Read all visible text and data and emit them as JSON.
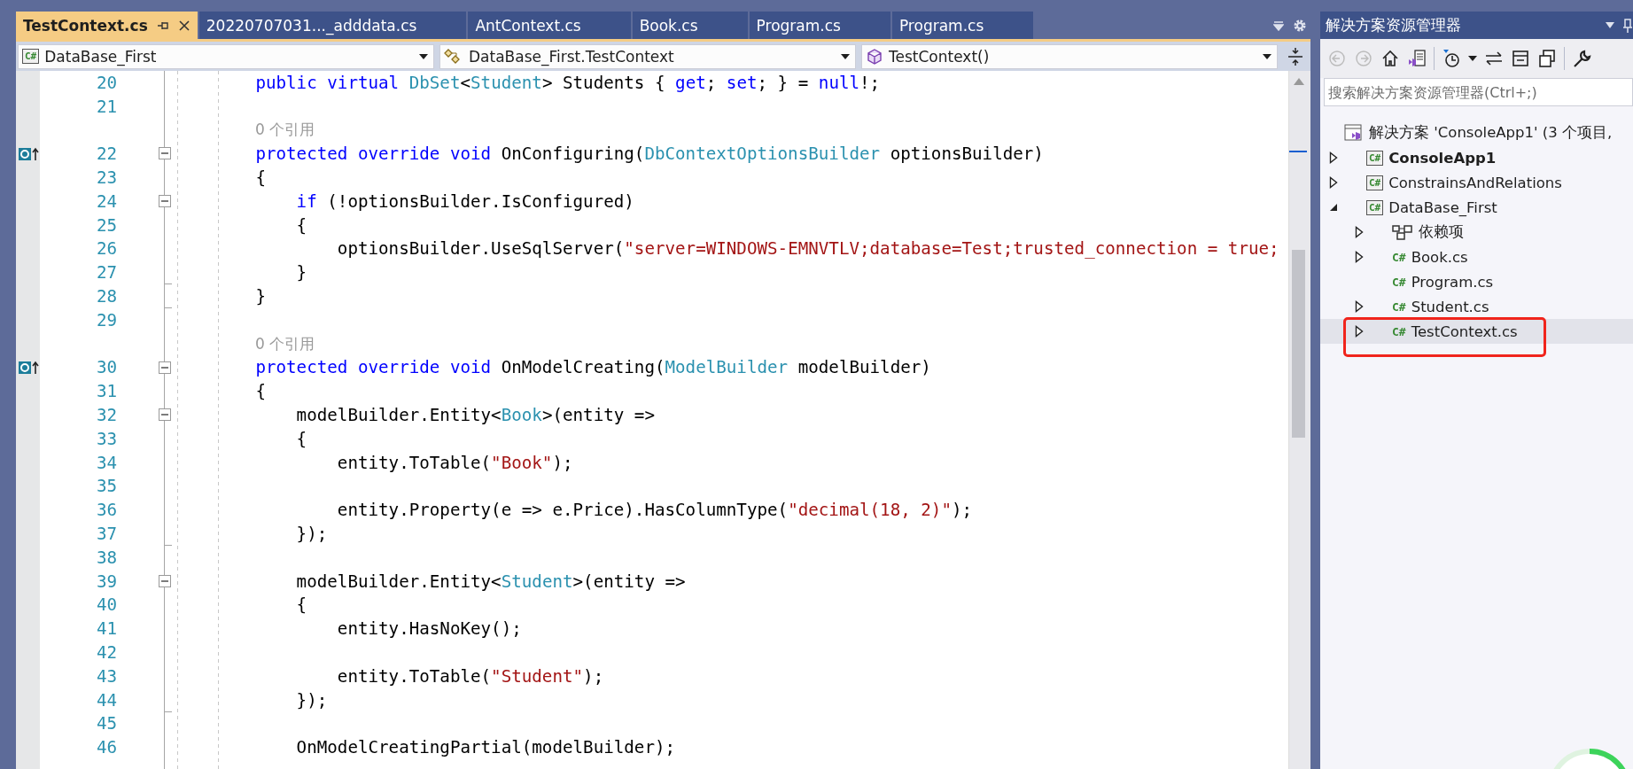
{
  "tabs": [
    {
      "label": "TestContext.cs",
      "selected": true
    },
    {
      "label": "20220707031..._adddata.cs",
      "selected": false
    },
    {
      "label": "AntContext.cs",
      "selected": false
    },
    {
      "label": "Book.cs",
      "selected": false
    },
    {
      "label": "Program.cs",
      "selected": false
    },
    {
      "label": "Program.cs",
      "selected": false
    }
  ],
  "navigation_bar": {
    "project": {
      "badge": "C#",
      "value": "DataBase_First"
    },
    "type": {
      "value": "DataBase_First.TestContext"
    },
    "member": {
      "value": "TestContext()"
    }
  },
  "editor": {
    "lines": [
      {
        "kind": "code",
        "number": "20",
        "collapsible": false,
        "block_end": false,
        "override": false,
        "segments": [
          {
            "kind": "keyword",
            "text": "        public virtual"
          },
          {
            "kind": "type",
            "text": " DbSet"
          },
          {
            "kind": "plain",
            "text": "<"
          },
          {
            "kind": "type",
            "text": "Student"
          },
          {
            "kind": "plain",
            "text": "> Students { "
          },
          {
            "kind": "keyword",
            "text": "get"
          },
          {
            "kind": "plain",
            "text": "; "
          },
          {
            "kind": "keyword",
            "text": "set"
          },
          {
            "kind": "plain",
            "text": "; } = "
          },
          {
            "kind": "keyword",
            "text": "null"
          },
          {
            "kind": "plain",
            "text": "!;"
          }
        ]
      },
      {
        "kind": "code",
        "number": "21",
        "collapsible": false,
        "block_end": false,
        "override": false
      },
      {
        "kind": "lens",
        "text": "0 个引用"
      },
      {
        "kind": "code",
        "number": "22",
        "collapsible": true,
        "block_end": false,
        "override": true,
        "segments": [
          {
            "kind": "keyword",
            "text": "        protected override void"
          },
          {
            "kind": "plain",
            "text": " OnConfiguring("
          },
          {
            "kind": "type",
            "text": "DbContextOptionsBuilder"
          },
          {
            "kind": "plain",
            "text": " optionsBuilder)"
          }
        ]
      },
      {
        "kind": "code",
        "number": "23",
        "collapsible": false,
        "block_end": false,
        "override": false,
        "segments": [
          {
            "kind": "plain",
            "text": "        {"
          }
        ]
      },
      {
        "kind": "code",
        "number": "24",
        "collapsible": true,
        "block_end": false,
        "override": false,
        "segments": [
          {
            "kind": "keyword",
            "text": "            if"
          },
          {
            "kind": "plain",
            "text": " (!optionsBuilder.IsConfigured)"
          }
        ]
      },
      {
        "kind": "code",
        "number": "25",
        "collapsible": false,
        "block_end": false,
        "override": false,
        "segments": [
          {
            "kind": "plain",
            "text": "            {"
          }
        ]
      },
      {
        "kind": "code",
        "number": "26",
        "collapsible": false,
        "block_end": false,
        "override": false,
        "segments": [
          {
            "kind": "plain",
            "text": "                optionsBuilder.UseSqlServer("
          },
          {
            "kind": "string",
            "text": "\"server=WINDOWS-EMNVTLV;database=Test;trusted_connection = true;"
          }
        ]
      },
      {
        "kind": "code",
        "number": "27",
        "collapsible": false,
        "block_end": true,
        "override": false,
        "segments": [
          {
            "kind": "plain",
            "text": "            }"
          }
        ]
      },
      {
        "kind": "code",
        "number": "28",
        "collapsible": false,
        "block_end": true,
        "override": false,
        "segments": [
          {
            "kind": "plain",
            "text": "        }"
          }
        ]
      },
      {
        "kind": "code",
        "number": "29",
        "collapsible": false,
        "block_end": false,
        "override": false
      },
      {
        "kind": "lens",
        "text": "0 个引用"
      },
      {
        "kind": "code",
        "number": "30",
        "collapsible": true,
        "block_end": false,
        "override": true,
        "segments": [
          {
            "kind": "keyword",
            "text": "        protected override void"
          },
          {
            "kind": "plain",
            "text": " OnModelCreating("
          },
          {
            "kind": "type",
            "text": "ModelBuilder"
          },
          {
            "kind": "plain",
            "text": " modelBuilder)"
          }
        ]
      },
      {
        "kind": "code",
        "number": "31",
        "collapsible": false,
        "block_end": false,
        "override": false,
        "segments": [
          {
            "kind": "plain",
            "text": "        {"
          }
        ]
      },
      {
        "kind": "code",
        "number": "32",
        "collapsible": true,
        "block_end": false,
        "override": false,
        "segments": [
          {
            "kind": "plain",
            "text": "            modelBuilder.Entity<"
          },
          {
            "kind": "type",
            "text": "Book"
          },
          {
            "kind": "plain",
            "text": ">(entity =>"
          }
        ]
      },
      {
        "kind": "code",
        "number": "33",
        "collapsible": false,
        "block_end": false,
        "override": false,
        "segments": [
          {
            "kind": "plain",
            "text": "            {"
          }
        ]
      },
      {
        "kind": "code",
        "number": "34",
        "collapsible": false,
        "block_end": false,
        "override": false,
        "segments": [
          {
            "kind": "plain",
            "text": "                entity.ToTable("
          },
          {
            "kind": "string",
            "text": "\"Book\""
          },
          {
            "kind": "plain",
            "text": ");"
          }
        ]
      },
      {
        "kind": "code",
        "number": "35",
        "collapsible": false,
        "block_end": false,
        "override": false
      },
      {
        "kind": "code",
        "number": "36",
        "collapsible": false,
        "block_end": false,
        "override": false,
        "segments": [
          {
            "kind": "plain",
            "text": "                entity.Property(e => e.Price).HasColumnType("
          },
          {
            "kind": "string",
            "text": "\"decimal(18, 2)\""
          },
          {
            "kind": "plain",
            "text": ");"
          }
        ]
      },
      {
        "kind": "code",
        "number": "37",
        "collapsible": false,
        "block_end": true,
        "override": false,
        "segments": [
          {
            "kind": "plain",
            "text": "            });"
          }
        ]
      },
      {
        "kind": "code",
        "number": "38",
        "collapsible": false,
        "block_end": false,
        "override": false
      },
      {
        "kind": "code",
        "number": "39",
        "collapsible": true,
        "block_end": false,
        "override": false,
        "segments": [
          {
            "kind": "plain",
            "text": "            modelBuilder.Entity<"
          },
          {
            "kind": "type",
            "text": "Student"
          },
          {
            "kind": "plain",
            "text": ">(entity =>"
          }
        ]
      },
      {
        "kind": "code",
        "number": "40",
        "collapsible": false,
        "block_end": false,
        "override": false,
        "segments": [
          {
            "kind": "plain",
            "text": "            {"
          }
        ]
      },
      {
        "kind": "code",
        "number": "41",
        "collapsible": false,
        "block_end": false,
        "override": false,
        "segments": [
          {
            "kind": "plain",
            "text": "                entity.HasNoKey();"
          }
        ]
      },
      {
        "kind": "code",
        "number": "42",
        "collapsible": false,
        "block_end": false,
        "override": false
      },
      {
        "kind": "code",
        "number": "43",
        "collapsible": false,
        "block_end": false,
        "override": false,
        "segments": [
          {
            "kind": "plain",
            "text": "                entity.ToTable("
          },
          {
            "kind": "string",
            "text": "\"Student\""
          },
          {
            "kind": "plain",
            "text": ");"
          }
        ]
      },
      {
        "kind": "code",
        "number": "44",
        "collapsible": false,
        "block_end": true,
        "override": false,
        "segments": [
          {
            "kind": "plain",
            "text": "            });"
          }
        ]
      },
      {
        "kind": "code",
        "number": "45",
        "collapsible": false,
        "block_end": false,
        "override": false
      },
      {
        "kind": "code",
        "number": "46",
        "collapsible": false,
        "block_end": false,
        "override": false,
        "segments": [
          {
            "kind": "plain",
            "text": "            OnModelCreatingPartial(modelBuilder);"
          }
        ]
      }
    ]
  },
  "solution_explorer": {
    "title": "解决方案资源管理器",
    "search": {
      "placeholder": "搜索解决方案资源管理器(Ctrl+;)"
    },
    "tree": [
      {
        "kind": "solution",
        "label": "解决方案 'ConsoleApp1' (3 个项目,",
        "expandable": false,
        "bold": false,
        "selected": false,
        "boxed": false,
        "children": [
          {
            "kind": "project",
            "badge": "C#",
            "label": "ConsoleApp1",
            "expandable": true,
            "expanded": false,
            "bold": true,
            "selected": false,
            "boxed": false
          },
          {
            "kind": "project",
            "badge": "C#",
            "label": "ConstrainsAndRelations",
            "expandable": true,
            "expanded": false,
            "bold": false,
            "selected": false,
            "boxed": false
          },
          {
            "kind": "project",
            "badge": "C#",
            "label": "DataBase_First",
            "expandable": true,
            "expanded": true,
            "bold": false,
            "selected": false,
            "boxed": false,
            "children": [
              {
                "kind": "dependencies",
                "label": "依赖项",
                "expandable": true,
                "expanded": false,
                "bold": false,
                "selected": false,
                "boxed": false
              },
              {
                "kind": "file",
                "badge": "C#",
                "label": "Book.cs",
                "expandable": true,
                "expanded": false,
                "bold": false,
                "selected": false,
                "boxed": false
              },
              {
                "kind": "file",
                "badge": "C#",
                "label": "Program.cs",
                "expandable": false,
                "bold": false,
                "selected": false,
                "boxed": false
              },
              {
                "kind": "file",
                "badge": "C#",
                "label": "Student.cs",
                "expandable": true,
                "expanded": false,
                "bold": false,
                "selected": false,
                "boxed": false
              },
              {
                "kind": "file",
                "badge": "C#",
                "label": "TestContext.cs",
                "expandable": true,
                "expanded": false,
                "bold": false,
                "selected": true,
                "boxed": true
              }
            ]
          }
        ]
      }
    ]
  }
}
